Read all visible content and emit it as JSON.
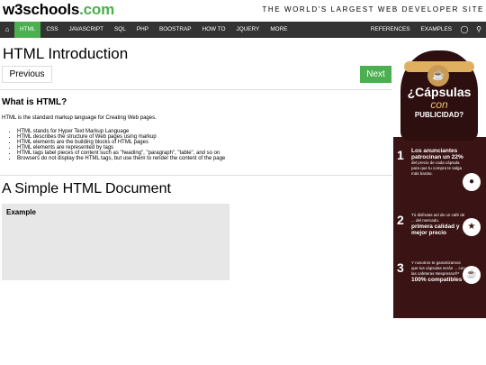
{
  "header": {
    "logo_w3": "w3schools",
    "logo_com": ".com",
    "tagline": "THE WORLD'S LARGEST WEB DEVELOPER SITE"
  },
  "nav": {
    "home_icon": "home-icon",
    "items": [
      "HTML",
      "CSS",
      "JAVASCRIPT",
      "SQL",
      "PHP",
      "BOOSTRAP",
      "HOW TO",
      "JQUERY",
      "MORE"
    ],
    "right_items": [
      "REFERENCES",
      "EXAMPLES"
    ],
    "globe_icon": "globe-icon",
    "search_icon": "search-icon"
  },
  "main": {
    "title": "HTML Introduction",
    "prev_label": "Previous",
    "next_label": "Next",
    "section_heading": "What is HTML?",
    "intro": "HTML is the standard markup language for Creating Web pages.",
    "bullets": [
      "HTML stands for Hyper Text Markup Language",
      "HTML describes the structure of Web pages using markup",
      "HTML elements are the building blocks of HTML pages",
      "HTML elements are represented by tags",
      "HTML tags label pieces of content such as \"heading\", \"paragraph\", \"table\", and so on",
      "Browsers do not display the HTML tags, but use them to render the content of the page"
    ],
    "doc_heading": "A Simple HTML Document",
    "example_label": "Example"
  },
  "ad": {
    "title_l1": "¿Cápsulas",
    "title_l2": "con",
    "title_l3": "PUBLICIDAD?",
    "steps": [
      {
        "num": "1",
        "bold": "Los anunciantes patrocinan un 22%",
        "text": "del precio de cada cápsula para que tu compra te salga más barato."
      },
      {
        "num": "2",
        "bold": "primera calidad y mejor precio",
        "text": "Tú disfrutas así de un café de ... del mercado."
      },
      {
        "num": "3",
        "bold": "100% compatibles",
        "text": "Y nosotros te garantizamos que tus cápsulas serán ... con las cafeteras Nespresso®*"
      }
    ]
  },
  "colors": {
    "accent": "#4CAF50",
    "nav_bg": "#333333",
    "example_bg": "#e7e7e7",
    "ad_bg": "#3a1414"
  }
}
